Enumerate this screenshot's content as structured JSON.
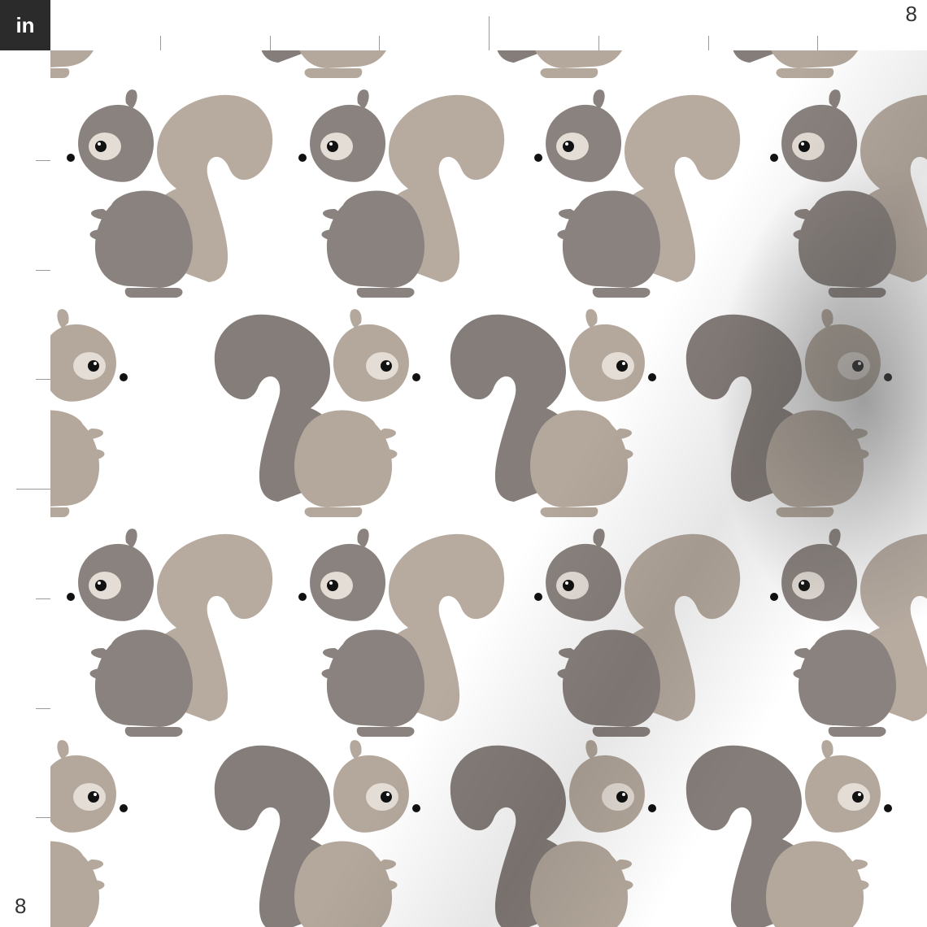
{
  "ruler": {
    "unit": "in",
    "top_end_label": "8",
    "left_end_label": "8"
  },
  "pattern": {
    "motif": "squirrel",
    "colors": {
      "gray_body": "#8a827e",
      "gray_dark": "#7c7572",
      "tan_body": "#b4a89c",
      "tan_light": "#c7bcb0",
      "eye_ring": "#e4ddd6",
      "pupil": "#111111"
    }
  }
}
